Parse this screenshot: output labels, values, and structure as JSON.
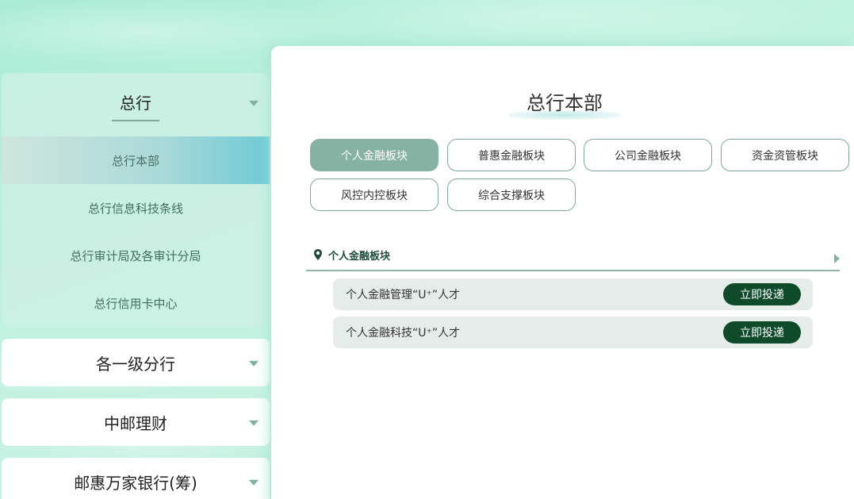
{
  "sidebar": {
    "expanded_group": {
      "title": "总行",
      "items": [
        {
          "label": "总行本部",
          "active": true
        },
        {
          "label": "总行信息科技条线"
        },
        {
          "label": "总行审计局及各审计分局"
        },
        {
          "label": "总行信用卡中心"
        }
      ]
    },
    "collapsed_groups": [
      {
        "title": "各一级分行"
      },
      {
        "title": "中邮理财"
      },
      {
        "title": "邮惠万家银行(筹)"
      }
    ]
  },
  "main": {
    "title": "总行本部",
    "tabs": [
      {
        "label": "个人金融板块",
        "active": true
      },
      {
        "label": "普惠金融板块"
      },
      {
        "label": "公司金融板块"
      },
      {
        "label": "资金资管板块"
      },
      {
        "label": "风控内控板块"
      },
      {
        "label": "综合支撑板块"
      }
    ],
    "section": {
      "title": "个人金融板块",
      "jobs": [
        {
          "name": "个人金融管理“U⁺”人才",
          "button": "立即投递"
        },
        {
          "name": "个人金融科技“U⁺”人才",
          "button": "立即投递"
        }
      ]
    }
  },
  "colors": {
    "accent": "#86b2a3",
    "button": "#0f4a2b",
    "section_title": "#1f4b3a"
  },
  "icons": {
    "dropdown": "chevron-down-icon",
    "location": "map-pin-icon",
    "expand": "chevron-right-icon"
  }
}
